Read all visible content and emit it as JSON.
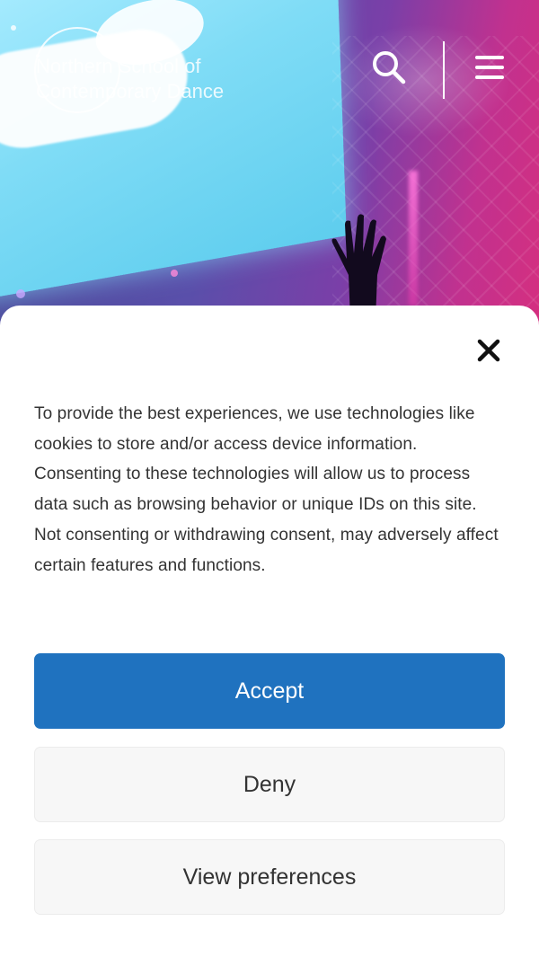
{
  "header": {
    "logo_text": "Northern School of\nContemporary Dance",
    "search_icon": "search-icon",
    "menu_icon": "hamburger-menu-icon"
  },
  "consent": {
    "close_icon": "close-icon",
    "message": "To provide the best experiences, we use technologies like cookies to store and/or access device information. Consenting to these technologies will allow us to process data such as browsing behavior or unique IDs on this site. Not consenting or withdrawing consent, may adversely affect certain features and functions.",
    "accept_label": "Accept",
    "deny_label": "Deny",
    "preferences_label": "View preferences"
  },
  "colors": {
    "accept_bg": "#1f72bf",
    "secondary_bg": "#f7f7f7",
    "text": "#333333"
  }
}
